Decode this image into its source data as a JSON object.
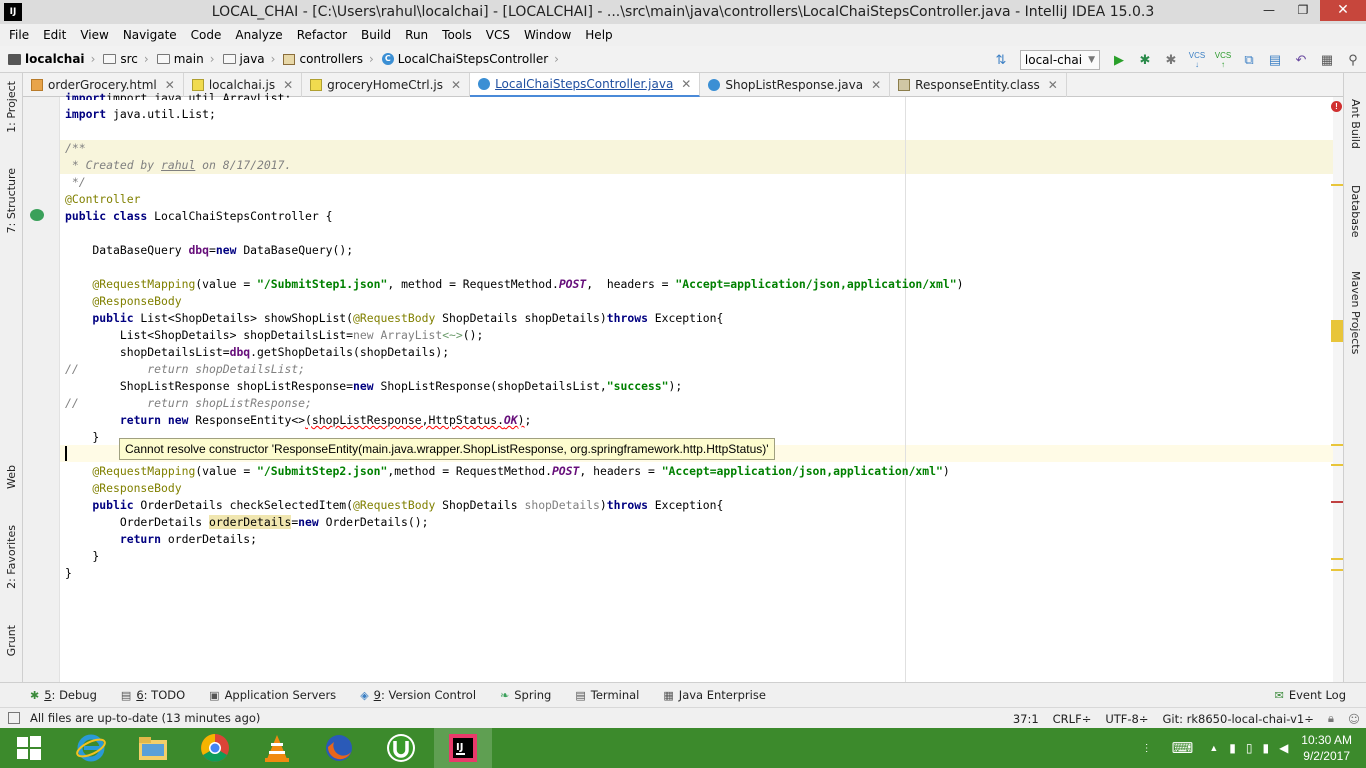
{
  "titlebar": {
    "logo": "IJ",
    "title": "LOCAL_CHAI - [C:\\Users\\rahul\\localchai] - [LOCALCHAI] - ...\\src\\main\\java\\controllers\\LocalChaiStepsController.java - IntelliJ IDEA 15.0.3",
    "minimize": "—",
    "restore": "❐",
    "close": "✕"
  },
  "menu": [
    "File",
    "Edit",
    "View",
    "Navigate",
    "Code",
    "Analyze",
    "Refactor",
    "Build",
    "Run",
    "Tools",
    "VCS",
    "Window",
    "Help"
  ],
  "breadcrumb": [
    "localchai",
    "src",
    "main",
    "java",
    "controllers",
    "LocalChaiStepsController"
  ],
  "toolbar": {
    "run_config": "local-chai",
    "vcs1": "VCS",
    "vcs2": "VCS"
  },
  "tabs": [
    {
      "label": "orderGrocery.html",
      "icon": "html-file-icon"
    },
    {
      "label": "localchai.js",
      "icon": "js-file-icon"
    },
    {
      "label": "groceryHomeCtrl.js",
      "icon": "js-file-icon"
    },
    {
      "label": "LocalChaiStepsController.java",
      "icon": "java-class-icon",
      "active": true
    },
    {
      "label": "ShopListResponse.java",
      "icon": "java-class-icon"
    },
    {
      "label": "ResponseEntity.class",
      "icon": "class-file-icon"
    }
  ],
  "left_tools": {
    "project": "1: Project",
    "structure": "7: Structure",
    "web": "Web",
    "favorites": "2: Favorites",
    "grunt": "Grunt"
  },
  "right_tools": {
    "ant": "Ant Build",
    "database": "Database",
    "maven": "Maven Projects"
  },
  "code": {
    "l0": "import java.util.ArrayList;",
    "l1": "import java.util.List;",
    "doc1": "/**",
    "doc2_a": " * Created by ",
    "doc2_b": "rahul",
    "doc2_c": " on 8/17/2017.",
    "doc3": " */",
    "ann_controller": "@Controller",
    "cls_public": "public class",
    "cls_name": " LocalChaiStepsController {",
    "dbq_a": "    DataBaseQuery ",
    "dbq_b": "dbq",
    "dbq_c": "=",
    "dbq_new": "new",
    "dbq_d": " DataBaseQuery();",
    "rm1_ann": "    @RequestMapping",
    "rm1_a": "(value = ",
    "rm1_s1": "\"/SubmitStep1.json\"",
    "rm1_b": ", method = RequestMethod.",
    "rm1_post": "POST",
    "rm1_c": ",  headers = ",
    "rm1_s2": "\"Accept=application/json,application/xml\"",
    "rm1_d": ")",
    "rb1": "    @ResponseBody",
    "m1_pub": "    public",
    "m1_a": " List<ShopDetails> showShopList(",
    "m1_ann": "@RequestBody",
    "m1_b": " ShopDetails shopDetails)",
    "m1_throws": "throws",
    "m1_c": " Exception{",
    "l_a": "        List<ShopDetails> shopDetailsList=",
    "l_new": "new",
    "l_b": " ArrayList",
    "l_diamond": "<~>",
    "l_c": "();",
    "g_a": "        shopDetailsList=",
    "g_dbq": "dbq",
    "g_b": ".getShopDetails(shopDetails);",
    "cm1": "//          return shopDetailsList;",
    "slr_a": "        ShopListResponse shopListResponse=",
    "slr_new": "new",
    "slr_b": " ShopListResponse(shopDetailsList,",
    "slr_s": "\"success\"",
    "slr_c": ");",
    "cm2": "//          return shopListResponse;",
    "ret_kw": "        return new",
    "ret_a": " ResponseEntity<>",
    "ret_err": "(shopListResponse,HttpStatus.",
    "ret_ok": "OK",
    "ret_end": ")",
    "ret_semi": ";",
    "close1": "    }",
    "rm2_ann": "    @RequestMapping",
    "rm2_a": "(value = ",
    "rm2_s1": "\"/SubmitStep2.json\"",
    "rm2_b": ",method = RequestMethod.",
    "rm2_post": "POST",
    "rm2_c": ", headers = ",
    "rm2_s2": "\"Accept=application/json,application/xml\"",
    "rm2_d": ")",
    "rb2": "    @ResponseBody",
    "m2_pub": "    public",
    "m2_a": " OrderDetails checkSelectedItem(",
    "m2_ann": "@RequestBody",
    "m2_b": " ShopDetails ",
    "m2_param": "shopDetails",
    "m2_c": ")",
    "m2_throws": "throws",
    "m2_d": " Exception{",
    "od_a": "        OrderDetails ",
    "od_var": "orderDetails",
    "od_b": "=",
    "od_new": "new",
    "od_c": " OrderDetails();",
    "r2_kw": "        return",
    "r2_a": " orderDetails;",
    "close2": "    }",
    "close3": "}"
  },
  "tooltip": "Cannot resolve constructor 'ResponseEntity(main.java.wrapper.ShopListResponse, org.springframework.http.HttpStatus)'",
  "bottom_tabs": [
    {
      "num": "5",
      "label": ": Debug",
      "icon": "debug-icon"
    },
    {
      "num": "6",
      "label": ": TODO",
      "icon": "todo-icon"
    },
    {
      "num": "",
      "label": "Application Servers",
      "icon": "server-icon"
    },
    {
      "num": "9",
      "label": ": Version Control",
      "icon": "vcs-icon"
    },
    {
      "num": "",
      "label": "Spring",
      "icon": "spring-icon"
    },
    {
      "num": "",
      "label": "Terminal",
      "icon": "terminal-icon"
    },
    {
      "num": "",
      "label": "Java Enterprise",
      "icon": "javaee-icon"
    }
  ],
  "event_log": "Event Log",
  "status": {
    "message": "All files are up-to-date (13 minutes ago)",
    "position": "37:1",
    "line_sep": "CRLF÷",
    "encoding": "UTF-8÷",
    "git": "Git: rk8650-local-chai-v1÷"
  },
  "clock": {
    "time": "10:30 AM",
    "date": "9/2/2017"
  },
  "colors": {
    "taskbar": "#3c8a2c",
    "keyword": "#000080",
    "annotation": "#808000",
    "string": "#008000",
    "error": "#ff0000"
  }
}
